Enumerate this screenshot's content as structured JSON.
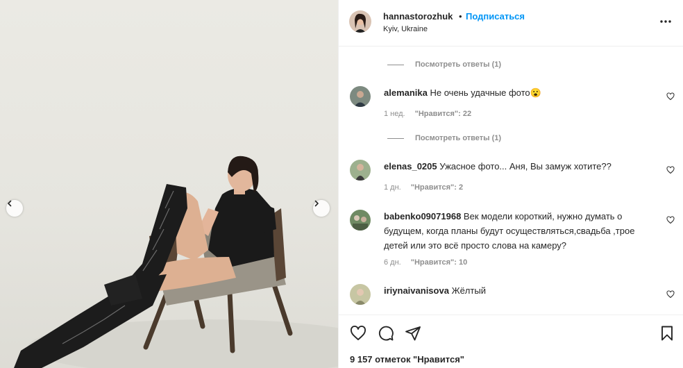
{
  "post": {
    "username": "hannastorozhuk",
    "separator": "•",
    "follow_label": "Подписаться",
    "location": "Kyiv, Ukraine"
  },
  "comments": [
    {
      "type": "replies",
      "label": "Посмотреть ответы (1)"
    },
    {
      "type": "comment",
      "user": "alemanika",
      "text": "Не очень удачные фото😮",
      "age": "1 нед.",
      "likes": "\"Нравится\": 22"
    },
    {
      "type": "replies",
      "label": "Посмотреть ответы (1)"
    },
    {
      "type": "comment",
      "user": "elenas_0205",
      "text": "Ужасное фото... Аня, Вы замуж хотите??",
      "age": "1 дн.",
      "likes": "\"Нравится\": 2"
    },
    {
      "type": "comment",
      "user": "babenko09071968",
      "text": "Век модели короткий, нужно думать о будущем, когда планы будут осуществляться,свадьба ,трое детей или это всё просто слова на камеру?",
      "age": "6 дн.",
      "likes": "\"Нравится\": 10"
    },
    {
      "type": "comment",
      "user": "iriynaivanisova",
      "text": "Жёлтый",
      "age": "",
      "likes": ""
    }
  ],
  "footer": {
    "likes_count": "9 157 отметок \"Нравится\""
  },
  "icons": {
    "like": "heart-icon",
    "comment": "comment-icon",
    "share": "share-icon",
    "save": "bookmark-icon",
    "more": "more-icon",
    "prev": "chevron-left-icon",
    "next": "chevron-right-icon"
  },
  "colors": {
    "link": "#0095f6",
    "secondary_text": "#8e8e8e",
    "border": "#efefef"
  }
}
